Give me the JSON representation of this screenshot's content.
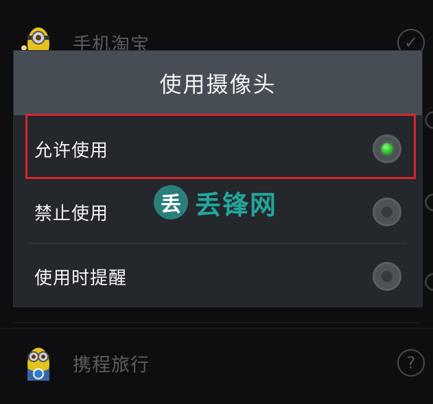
{
  "background_list": {
    "items": [
      {
        "name": "手机淘宝",
        "icon": "minion-app-icon",
        "status_icon": "check-circle-icon",
        "status_glyph": "✓"
      },
      {
        "name": "携程旅行",
        "icon": "minion-app-icon",
        "status_icon": "question-circle-icon",
        "status_glyph": "?"
      }
    ]
  },
  "dialog": {
    "title": "使用摄像头",
    "options": [
      {
        "label": "允许使用",
        "selected": true
      },
      {
        "label": "禁止使用",
        "selected": false
      },
      {
        "label": "使用时提醒",
        "selected": false
      }
    ]
  },
  "watermark": {
    "badge": "丢",
    "text": "丢锋网"
  },
  "colors": {
    "dialog_header": "#464d55",
    "dialog_body": "#24272b",
    "radio_checked": "#2ec52a",
    "highlight": "#d6252e",
    "watermark": "#23a69d"
  }
}
